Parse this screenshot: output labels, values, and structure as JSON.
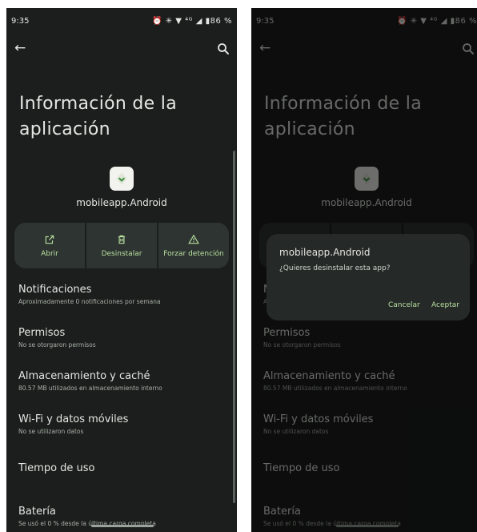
{
  "status_bar": {
    "time": "9:35",
    "icons_text": "⏰ ✳ ▼ ⁴ᴳ ◢ ▮",
    "battery": "86 %"
  },
  "page": {
    "title": "Información de la aplicación",
    "app_name": "mobileapp.Android"
  },
  "actions": [
    {
      "label": "Abrir",
      "icon": "open-external-icon"
    },
    {
      "label": "Desinstalar",
      "icon": "trash-icon"
    },
    {
      "label": "Forzar detención",
      "icon": "warning-triangle-icon"
    }
  ],
  "settings": [
    {
      "title": "Notificaciones",
      "subtitle": "Aproximadamente 0 notificaciones por semana"
    },
    {
      "title": "Permisos",
      "subtitle": "No se otorgaron permisos"
    },
    {
      "title": "Almacenamiento y caché",
      "subtitle": "80.57 MB utilizados en almacenamiento interno"
    },
    {
      "title": "Wi-Fi y datos móviles",
      "subtitle": "No se utilizaron datos"
    },
    {
      "title": "Tiempo de uso",
      "subtitle": ""
    },
    {
      "title": "Batería",
      "subtitle": "Se usó el 0 % desde la última carga completa"
    }
  ],
  "dialog": {
    "title": "mobileapp.Android",
    "message": "¿Quieres desinstalar esta app?",
    "cancel_label": "Cancelar",
    "accept_label": "Aceptar"
  },
  "colors": {
    "background": "#1b1e1c",
    "accent": "#b8e0a0",
    "surface": "#2e3431"
  }
}
